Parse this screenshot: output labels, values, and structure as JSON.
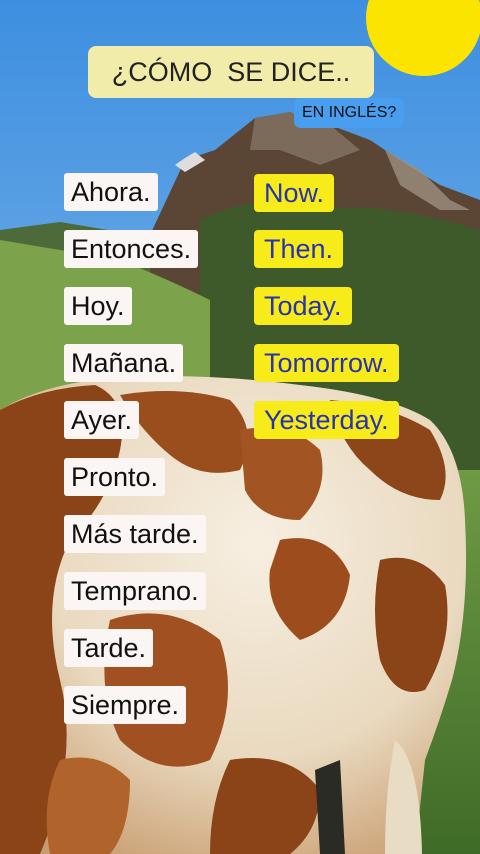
{
  "title": "¿CÓMO  SE DICE..",
  "subtitle": "EN INGLÉS?",
  "colors": {
    "sky": "#4f9be2",
    "sun": "#fbe500",
    "mountain": "#5b4636",
    "grass": "#4e7b33",
    "cow_brown": "#8a4418",
    "cow_cream": "#f3e9d8",
    "label_bg": "#fbf6f4",
    "answer_bg": "#f7ec19",
    "answer_text": "#2733b0"
  },
  "spanish": [
    "Ahora.",
    "Entonces.",
    "Hoy.",
    "Mañana.",
    "Ayer.",
    "Pronto.",
    "Más tarde.",
    "Temprano.",
    "Tarde.",
    "Siempre."
  ],
  "english": [
    "Now.",
    "Then.",
    "Today.",
    "Tomorrow.",
    "Yesterday."
  ]
}
